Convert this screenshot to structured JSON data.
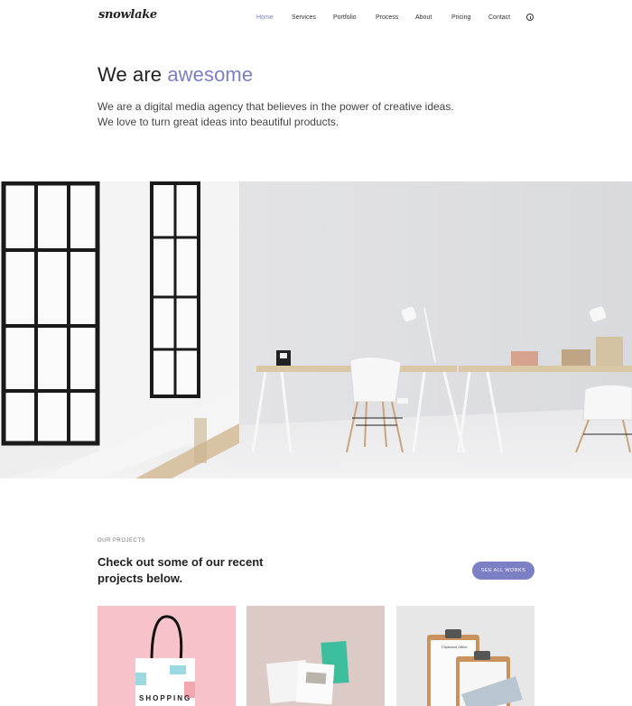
{
  "brand": {
    "logo": "snowlake"
  },
  "nav": {
    "items": [
      {
        "label": "Home",
        "active": true
      },
      {
        "label": "Services"
      },
      {
        "label": "Portfolio"
      },
      {
        "label": "Process"
      },
      {
        "label": "About"
      },
      {
        "label": "Pricing"
      },
      {
        "label": "Contact"
      }
    ],
    "info_icon": "info-circle-icon"
  },
  "hero": {
    "title_prefix": "We are",
    "title_accent": "awesome",
    "description": "We are a digital media agency that believes in the power of creative ideas. We love to turn great ideas into beautiful products."
  },
  "projects": {
    "eyebrow": "OUR PROJECTS",
    "title": "Check out some of our recent projects below.",
    "cta": "SEE ALL WORKS",
    "cards": [
      {
        "caption": "SHOPPING"
      },
      {
        "caption": ""
      },
      {
        "caption": "Clipboard Office"
      }
    ]
  },
  "colors": {
    "accent": "#7b7fc4",
    "card_pink": "#f7c2c9",
    "card_beige": "#dccac6",
    "card_gray": "#e7e7e7"
  }
}
